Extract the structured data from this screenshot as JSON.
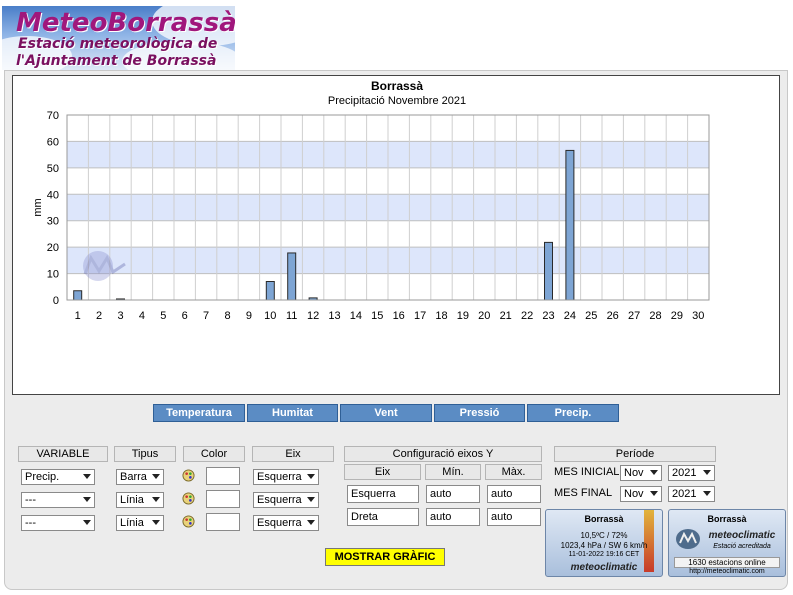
{
  "header": {
    "title": "MeteoBorrassà",
    "subtitle_line1": "Estació meteorològica de",
    "subtitle_line2": "l'Ajuntament de Borrassà"
  },
  "chart_data": {
    "type": "bar",
    "title": "Borrassà",
    "subtitle": "Precipitació Novembre 2021",
    "ylabel": "mm",
    "xlabel": "",
    "ylim": [
      0,
      70
    ],
    "yticks": [
      0,
      10,
      20,
      30,
      40,
      50,
      60,
      70
    ],
    "categories": [
      "1",
      "2",
      "3",
      "4",
      "5",
      "6",
      "7",
      "8",
      "9",
      "10",
      "11",
      "12",
      "13",
      "14",
      "15",
      "16",
      "17",
      "18",
      "19",
      "20",
      "21",
      "22",
      "23",
      "24",
      "25",
      "26",
      "27",
      "28",
      "29",
      "30"
    ],
    "values": [
      3.5,
      0,
      0.4,
      0,
      0,
      0,
      0,
      0,
      0,
      7,
      17.8,
      0.8,
      0,
      0,
      0,
      0,
      0,
      0,
      0,
      0,
      0,
      0,
      21.8,
      56.6,
      0,
      0,
      0,
      0,
      0,
      0
    ],
    "colors": {
      "bar": "#7ea5d4",
      "bar_stroke": "#2a2a2a",
      "band": "#dde6fb"
    },
    "grid": true,
    "legend": "none"
  },
  "variable_buttons": [
    "Temperatura",
    "Humitat",
    "Vent",
    "Pressió",
    "Precip."
  ],
  "config": {
    "headers": {
      "variable": "VARIABLE",
      "tipus": "Tipus",
      "color": "Color",
      "eix": "Eix"
    },
    "rows": [
      {
        "variable": "Precip.",
        "tipus": "Barra",
        "eix": "Esquerra"
      },
      {
        "variable": "---",
        "tipus": "Línia",
        "eix": "Esquerra"
      },
      {
        "variable": "---",
        "tipus": "Línia",
        "eix": "Esquerra"
      }
    ]
  },
  "axes_config": {
    "title": "Configuració eixos Y",
    "headers": {
      "eix": "Eix",
      "min": "Mín.",
      "max": "Màx."
    },
    "rows": [
      {
        "eix": "Esquerra",
        "min": "auto",
        "max": "auto"
      },
      {
        "eix": "Dreta",
        "min": "auto",
        "max": "auto"
      }
    ]
  },
  "period": {
    "title": "Període",
    "start_label": "MES INICIAL",
    "start_month": "Nov",
    "start_year": "2021",
    "end_label": "MES FINAL",
    "end_month": "Nov",
    "end_year": "2021"
  },
  "show_button": "MOSTRAR GRÀFIC",
  "widget_left": {
    "station": "Borrassà",
    "line1": "10,5ºC / 72%",
    "line2": "1023,4 hPa / SW 6 km/h",
    "line3": "11-01-2022 19:16 CET",
    "brand": "meteoclimatic"
  },
  "widget_right": {
    "station": "Borrassà",
    "brand": "meteoclimatic",
    "tagline": "Estació acreditada",
    "online": "1630 estacions online",
    "url": "http://meteoclimatic.com"
  }
}
